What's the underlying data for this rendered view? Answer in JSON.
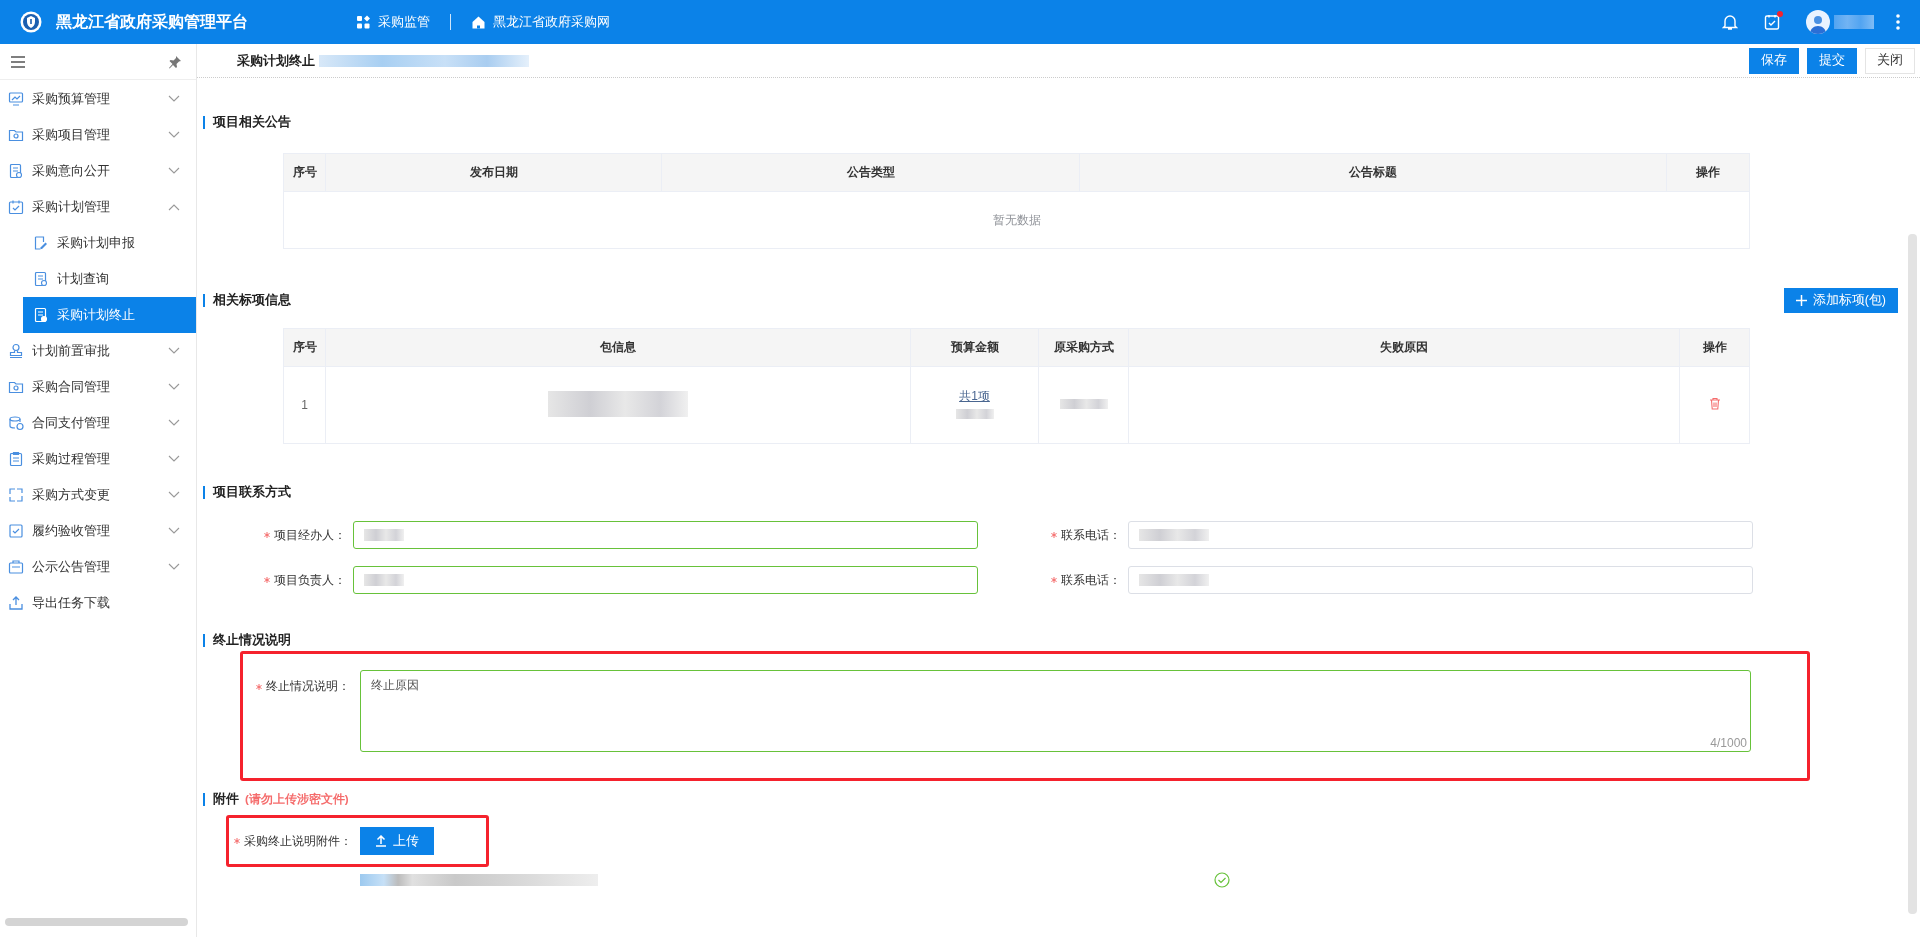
{
  "header": {
    "title": "黑龙江省政府采购管理平台",
    "links": [
      {
        "label": "采购监管",
        "kind": "apps"
      },
      {
        "label": "黑龙江省政府采购网",
        "kind": "home"
      }
    ],
    "tasks_badge": true
  },
  "sidebar": {
    "items": [
      {
        "label": "采购预算管理",
        "expanded": false,
        "selected": false
      },
      {
        "label": "采购项目管理",
        "expanded": false,
        "selected": false
      },
      {
        "label": "采购意向公开",
        "expanded": false,
        "selected": false
      },
      {
        "label": "采购计划管理",
        "expanded": true,
        "selected": false,
        "children": [
          {
            "label": "采购计划申报",
            "selected": false
          },
          {
            "label": "计划查询",
            "selected": false
          },
          {
            "label": "采购计划终止",
            "selected": true
          }
        ]
      },
      {
        "label": "计划前置审批",
        "expanded": false,
        "selected": false
      },
      {
        "label": "采购合同管理",
        "expanded": false,
        "selected": false
      },
      {
        "label": "合同支付管理",
        "expanded": false,
        "selected": false
      },
      {
        "label": "采购过程管理",
        "expanded": false,
        "selected": false
      },
      {
        "label": "采购方式变更",
        "expanded": false,
        "selected": false
      },
      {
        "label": "履约验收管理",
        "expanded": false,
        "selected": false
      },
      {
        "label": "公示公告管理",
        "expanded": false,
        "selected": false
      },
      {
        "label": "导出任务下载",
        "selected": false
      }
    ]
  },
  "page": {
    "title": "采购计划终止",
    "actions": [
      {
        "label": "保存",
        "kind": "primary"
      },
      {
        "label": "提交",
        "kind": "primary"
      },
      {
        "label": "关闭",
        "kind": "default"
      }
    ]
  },
  "announcements": {
    "title": "项目相关公告",
    "columns": [
      "序号",
      "发布日期",
      "公告类型",
      "公告标题",
      "操作"
    ],
    "empty_text": "暂无数据"
  },
  "lots": {
    "title": "相关标项信息",
    "add_button": "添加标项(包)",
    "columns": [
      "序号",
      "包信息",
      "预算金额",
      "原采购方式",
      "失败原因",
      "操作"
    ],
    "rows": [
      {
        "index": "1",
        "budget_link": "共1项"
      }
    ]
  },
  "contacts": {
    "title": "项目联系方式",
    "fields": [
      {
        "label": "项目经办人：",
        "required": true,
        "valid": true
      },
      {
        "label": "联系电话：",
        "required": true,
        "valid": false
      },
      {
        "label": "项目负责人：",
        "required": true,
        "valid": true
      },
      {
        "label": "联系电话：",
        "required": true,
        "valid": false
      }
    ]
  },
  "termination": {
    "title": "终止情况说明",
    "label": "终止情况说明：",
    "required": true,
    "valid": true,
    "value": "终止原因",
    "counter": "4/1000",
    "highlighted": true
  },
  "attachment": {
    "title": "附件",
    "warning": "(请勿上传涉密文件)",
    "label": "采购终止说明附件：",
    "required": true,
    "button": "上传",
    "highlighted": true
  }
}
